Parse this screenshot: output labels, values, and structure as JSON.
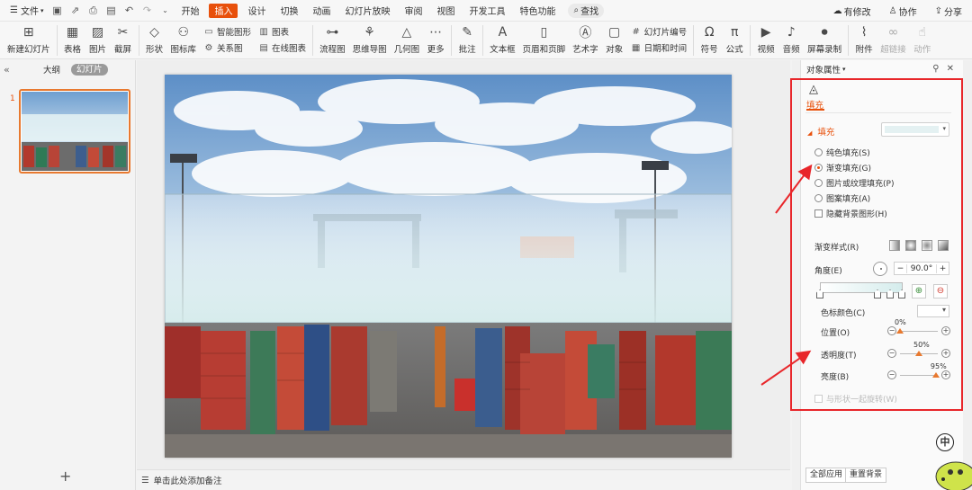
{
  "menubar": {
    "file_label": "文件",
    "tabs": [
      "开始",
      "插入",
      "设计",
      "切换",
      "动画",
      "幻灯片放映",
      "审阅",
      "视图",
      "开发工具",
      "特色功能"
    ],
    "active_tab": "插入",
    "search_label": "查找",
    "right": {
      "changes": "有修改",
      "collab": "协作",
      "share": "分享"
    }
  },
  "ribbon": {
    "new_slide": "新建幻灯片",
    "table": "表格",
    "picture": "图片",
    "screenshot": "截屏",
    "shape": "形状",
    "icon_lib": "图标库",
    "smart_graphic": "智能图形",
    "relation": "关系图",
    "chart": "图表",
    "online_chart": "在线图表",
    "flowchart": "流程图",
    "mindmap": "思维导图",
    "geometry": "几何图",
    "more": "更多",
    "comment": "批注",
    "textbox": "文本框",
    "header_footer": "页眉和页脚",
    "wordart": "艺术字",
    "object": "对象",
    "slide_number": "幻灯片编号",
    "datetime": "日期和时间",
    "symbol": "符号",
    "formula": "公式",
    "video": "视频",
    "audio": "音频",
    "screen_record": "屏幕录制",
    "attachment": "附件",
    "hyperlink": "超链接",
    "action": "动作"
  },
  "left_panel": {
    "tab_outline": "大纲",
    "tab_slides": "幻灯片",
    "slide_number": "1",
    "add_symbol": "+"
  },
  "notes": {
    "placeholder": "单击此处添加备注"
  },
  "right_panel": {
    "title": "对象属性",
    "tab_fill": "填充",
    "section_fill": "填充",
    "fill_options": [
      {
        "label": "纯色填充(S)",
        "selected": false
      },
      {
        "label": "渐变填充(G)",
        "selected": true
      },
      {
        "label": "图片或纹理填充(P)",
        "selected": false
      },
      {
        "label": "图案填充(A)",
        "selected": false
      }
    ],
    "hide_bg": "隐藏背景图形(H)",
    "gradient_style": "渐变样式(R)",
    "angle_label": "角度(E)",
    "angle_value": "90.0°",
    "stop_color": "色标颜色(C)",
    "position_label": "位置(O)",
    "position_value": "0%",
    "transparency_label": "透明度(T)",
    "transparency_value": "50%",
    "brightness_label": "亮度(B)",
    "brightness_value": "95%",
    "rotate_with_shape": "与形状一起旋转(W)",
    "apply_all": "全部应用",
    "reset_bg": "重置背景",
    "colors": {
      "accent": "#e8500b",
      "highlight_box": "#e8262a"
    }
  },
  "status": {
    "ime": "中"
  }
}
